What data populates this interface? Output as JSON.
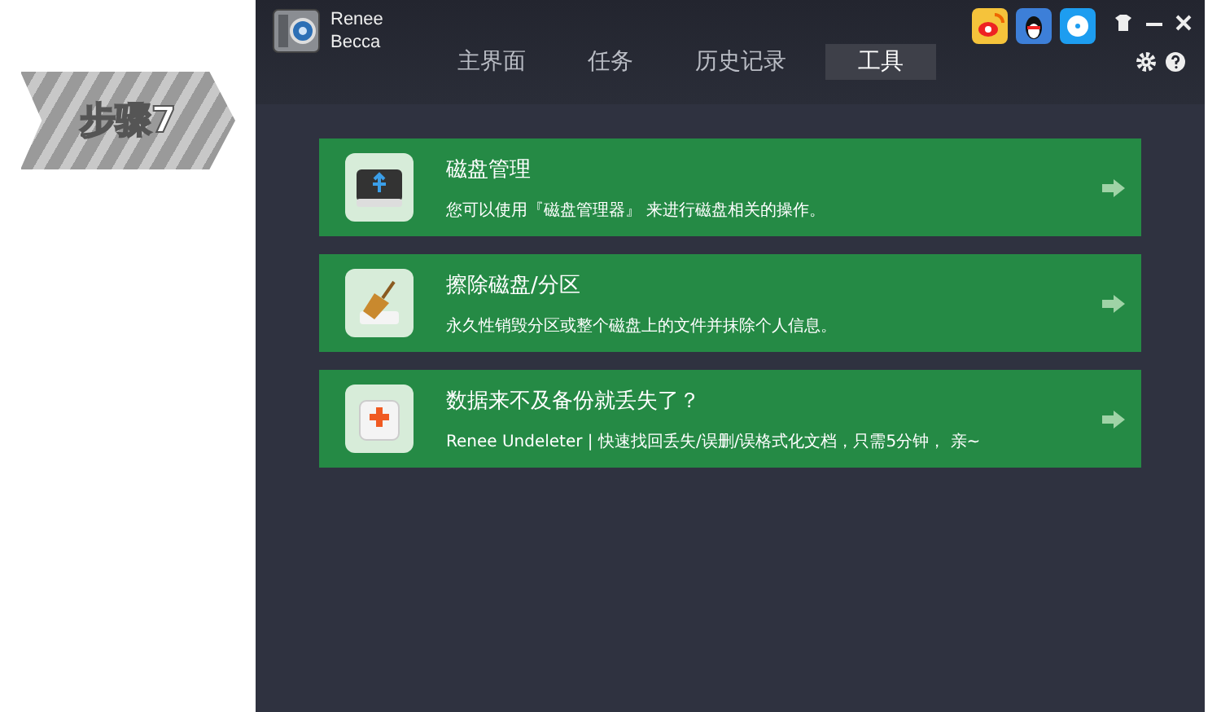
{
  "step_badge": {
    "label": "步骤7"
  },
  "app": {
    "name_line1": "Renee",
    "name_line2": "Becca"
  },
  "tabs": [
    {
      "label": "主界面",
      "selected": false
    },
    {
      "label": "任务",
      "selected": false
    },
    {
      "label": "历史记录",
      "selected": false
    },
    {
      "label": "工具",
      "selected": true
    }
  ],
  "tools": [
    {
      "kind": "disk",
      "title": "磁盘管理",
      "description": "您可以使用『磁盘管理器』 来进行磁盘相关的操作。"
    },
    {
      "kind": "wipe",
      "title": "擦除磁盘/分区",
      "description": "永久性销毁分区或整个磁盘上的文件并抹除个人信息。"
    },
    {
      "kind": "rescue",
      "title": "数据来不及备份就丢失了？",
      "description": "Renee Undeleter | 快速找回丢失/误删/误格式化文档，只需5分钟， 亲~"
    }
  ]
}
